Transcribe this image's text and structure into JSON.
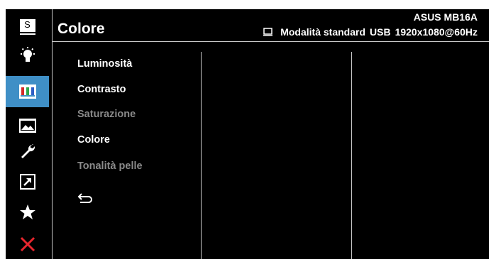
{
  "header": {
    "title": "Colore",
    "model": "ASUS MB16A",
    "mode": "Modalità standard",
    "input": "USB",
    "resolution": "1920x1080@60Hz"
  },
  "sidebar": {
    "items": [
      {
        "icon": "splendid-s-icon"
      },
      {
        "icon": "brightness-bulb-icon"
      },
      {
        "icon": "color-bars-icon",
        "active": true
      },
      {
        "icon": "image-icon"
      },
      {
        "icon": "wrench-icon"
      },
      {
        "icon": "shortcut-arrow-icon"
      },
      {
        "icon": "star-icon"
      },
      {
        "icon": "close-x-icon"
      }
    ],
    "s_glyph": "S"
  },
  "menu": {
    "items": [
      {
        "label": "Luminosità",
        "enabled": true
      },
      {
        "label": "Contrasto",
        "enabled": true
      },
      {
        "label": "Saturazione",
        "enabled": false
      },
      {
        "label": "Colore",
        "enabled": true
      },
      {
        "label": "Tonalità pelle",
        "enabled": false
      }
    ]
  },
  "colors": {
    "background": "#000000",
    "accent": "#3f8fc6",
    "text": "#ffffff",
    "disabled_text": "#8a8a8a",
    "close": "#e8262e"
  }
}
